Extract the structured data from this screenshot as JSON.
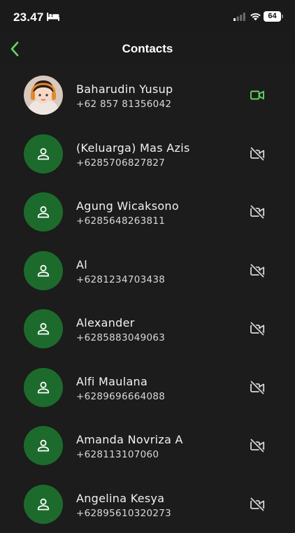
{
  "status_bar": {
    "time": "23.47",
    "battery": "64"
  },
  "nav": {
    "title": "Contacts"
  },
  "colors": {
    "accent": "#5fd35f",
    "avatar_bg": "#1d6b2c",
    "background": "#1b1c1b"
  },
  "contacts": [
    {
      "name": "Baharudin Yusup",
      "phone": "+62 857 81356042",
      "avatar": "photo",
      "video": "video-camera-icon"
    },
    {
      "name": "(Keluarga) Mas Azis",
      "phone": "+6285706827827",
      "avatar": "person-icon",
      "video": "video-off-icon"
    },
    {
      "name": "Agung Wicaksono",
      "phone": "+6285648263811",
      "avatar": "person-icon",
      "video": "video-off-icon"
    },
    {
      "name": "Al",
      "phone": "+6281234703438",
      "avatar": "person-icon",
      "video": "video-off-icon"
    },
    {
      "name": "Alexander",
      "phone": "+6285883049063",
      "avatar": "person-icon",
      "video": "video-off-icon"
    },
    {
      "name": "Alfi Maulana",
      "phone": "+6289696664088",
      "avatar": "person-icon",
      "video": "video-off-icon"
    },
    {
      "name": "Amanda Novriza A",
      "phone": "+628113107060",
      "avatar": "person-icon",
      "video": "video-off-icon"
    },
    {
      "name": "Angelina Kesya",
      "phone": "+62895610320273",
      "avatar": "person-icon",
      "video": "video-off-icon"
    }
  ]
}
